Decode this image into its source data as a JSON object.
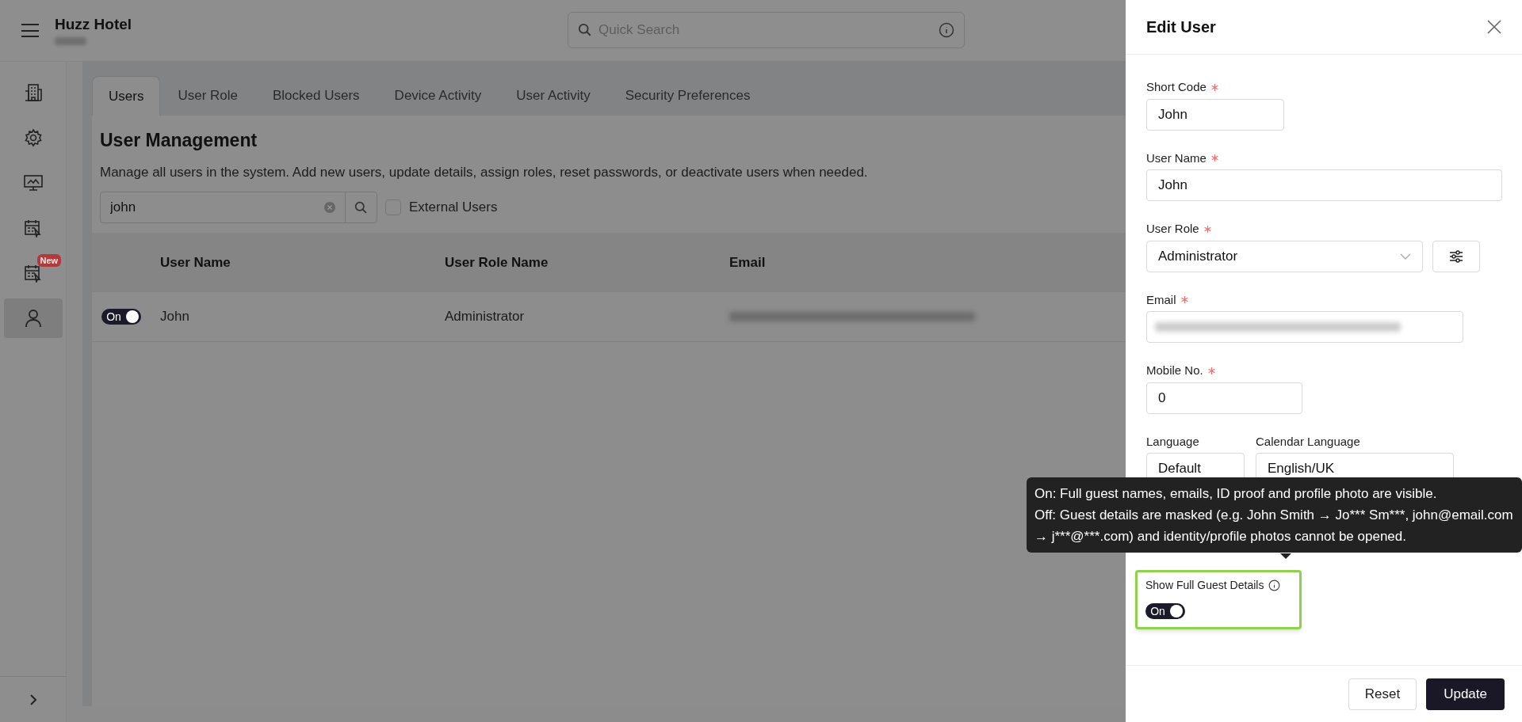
{
  "header": {
    "hotel_name": "Huzz Hotel",
    "search": {
      "placeholder": "Quick Search"
    }
  },
  "sidebar": {
    "items": [
      {
        "kind": "building",
        "selected": false
      },
      {
        "kind": "settings",
        "selected": false
      },
      {
        "kind": "monitor",
        "selected": false
      },
      {
        "kind": "calendar",
        "selected": false
      },
      {
        "kind": "calendar",
        "selected": false,
        "badge": "New"
      },
      {
        "kind": "user",
        "selected": true
      }
    ]
  },
  "tabs": [
    {
      "label": "Users",
      "selected": true
    },
    {
      "label": "User Role",
      "selected": false
    },
    {
      "label": "Blocked Users",
      "selected": false
    },
    {
      "label": "Device Activity",
      "selected": false
    },
    {
      "label": "User Activity",
      "selected": false
    },
    {
      "label": "Security Preferences",
      "selected": false
    }
  ],
  "page": {
    "title": "User Management",
    "description": "Manage all users in the system. Add new users, update details, assign roles, reset passwords, or deactivate users when needed.",
    "search": {
      "value": "john"
    },
    "external_users": {
      "label": "External Users",
      "checked": false
    }
  },
  "table": {
    "columns": [
      "User Name",
      "User Role Name",
      "Email"
    ],
    "rows": [
      {
        "active": true,
        "toggle_label": "On",
        "user_name": "John",
        "user_role": "Administrator"
      }
    ]
  },
  "drawer": {
    "title": "Edit User",
    "fields": [
      {
        "kind": "text",
        "label": "Short Code",
        "required": true,
        "value": "John"
      },
      {
        "kind": "text",
        "label": "User Name",
        "required": true,
        "value": "John"
      },
      {
        "kind": "select-with-button",
        "label": "User Role",
        "required": true,
        "value": "Administrator"
      },
      {
        "kind": "blurred",
        "label": "Email",
        "required": true
      },
      {
        "kind": "text",
        "label": "Mobile No.",
        "required": true,
        "value": "0"
      }
    ],
    "selects": [
      {
        "label": "Language",
        "value": "Default"
      },
      {
        "label": "Calendar Language",
        "value": "English/UK"
      }
    ],
    "tooltip": {
      "lines": [
        "On: Full guest names, emails, ID proof and profile photo are visible.",
        "Off: Guest details are masked (e.g. John Smith → Jo*** Sm***, john@email.com → j***@***.com) and identity/profile photos cannot be opened."
      ]
    },
    "guest_details": {
      "label": "Show Full Guest Details",
      "on": true,
      "toggle_label": "On"
    },
    "buttons": [
      {
        "label": "Reset",
        "kind": "secondary"
      },
      {
        "label": "Update",
        "kind": "primary"
      }
    ]
  }
}
